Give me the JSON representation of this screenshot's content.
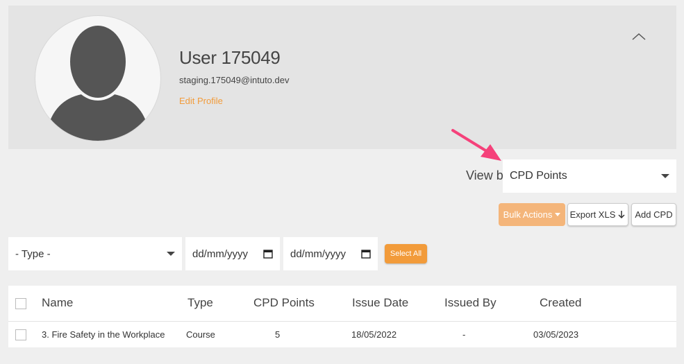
{
  "profile": {
    "name": "User 175049",
    "email": "staging.175049@intuto.dev",
    "edit_label": "Edit Profile"
  },
  "view_by": {
    "label": "View by",
    "selected": "CPD Points"
  },
  "actions": {
    "bulk_label": "Bulk Actions",
    "export_label": "Export XLS",
    "add_label": "Add CPD",
    "select_all_label": "Select All"
  },
  "filters": {
    "type_selected": "- Type -",
    "date_from_placeholder": "dd/mm/yyyy",
    "date_to_placeholder": "dd/mm/yyyy"
  },
  "table": {
    "headers": [
      "Name",
      "Type",
      "CPD Points",
      "Issue Date",
      "Issued By",
      "Created"
    ],
    "rows": [
      [
        "3. Fire Safety in the Workplace",
        "Course",
        "5",
        "18/05/2022",
        "-",
        "03/05/2023"
      ]
    ]
  },
  "colors": {
    "accent": "#f29b3a",
    "accent_light": "#f4b57a",
    "annotation_arrow": "#f5417a"
  }
}
